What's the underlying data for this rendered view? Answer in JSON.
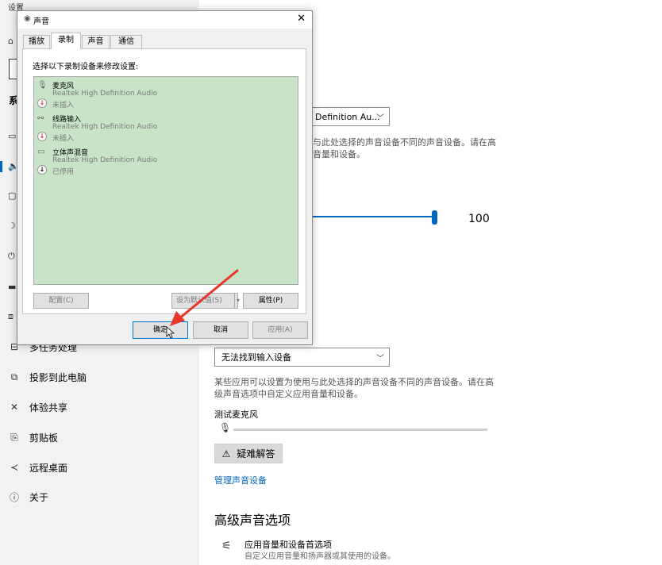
{
  "settings": {
    "window_title": "设置",
    "nav_items": [
      {
        "label": "多任务处理",
        "icon": "multitask-icon",
        "glyph": "⊟"
      },
      {
        "label": "投影到此电脑",
        "icon": "project-icon",
        "glyph": "⧉"
      },
      {
        "label": "体验共享",
        "icon": "share-icon",
        "glyph": "✕"
      },
      {
        "label": "剪贴板",
        "icon": "clipboard-icon",
        "glyph": "⎘"
      },
      {
        "label": "远程桌面",
        "icon": "remote-desktop-icon",
        "glyph": "≺"
      },
      {
        "label": "关于",
        "icon": "info-icon",
        "glyph": "ⓘ"
      }
    ],
    "side_text_fragment": "系",
    "output": {
      "device_dropdown_visible_text": "Definition Au...",
      "description_line1": "与此处选择的声音设备不同的声音设备。请在高",
      "description_line2": "音量和设备。",
      "volume_value": "100",
      "volume_level": 1.0
    },
    "input": {
      "device_dropdown": "无法找到输入设备",
      "description_line1": "某些应用可以设置为使用与此处选择的声音设备不同的声音设备。请在高",
      "description_line2": "级声音选项中自定义应用音量和设备。",
      "test_mic_label": "测试麦克风",
      "troubleshoot_label": "疑难解答",
      "manage_link": "管理声音设备"
    },
    "advanced": {
      "title": "高级声音选项",
      "item_title": "应用音量和设备首选项",
      "item_subtitle": "自定义应用音量和扬声器或其使用的设备。"
    }
  },
  "dialog": {
    "title": "声音",
    "close_glyph": "✕",
    "tabs": [
      "播放",
      "录制",
      "声音",
      "通信"
    ],
    "active_tab": "录制",
    "hint": "选择以下录制设备来修改设置:",
    "devices": [
      {
        "name": "麦克风",
        "driver": "Realtek High Definition Audio",
        "status": "未插入",
        "badge": "↓",
        "badge_color": "#d42020",
        "icon": "microphone-icon",
        "glyph": "🎙"
      },
      {
        "name": "线路输入",
        "driver": "Realtek High Definition Audio",
        "status": "未插入",
        "badge": "↓",
        "badge_color": "#d42020",
        "icon": "line-in-icon",
        "glyph": "⚯"
      },
      {
        "name": "立体声混音",
        "driver": "Realtek High Definition Audio",
        "status": "已停用",
        "badge": "↓",
        "badge_color": "#000000",
        "icon": "stereo-mix-icon",
        "glyph": "▭"
      }
    ],
    "buttons": {
      "configure": "配置(C)",
      "set_default": "设为默认值(S)",
      "properties": "属性(P)",
      "ok": "确定",
      "cancel": "取消",
      "apply": "应用(A)"
    }
  },
  "colors": {
    "accent": "#0067c0",
    "device_list_bg": "#c9e3c9",
    "annotation_arrow": "#e8352b"
  }
}
